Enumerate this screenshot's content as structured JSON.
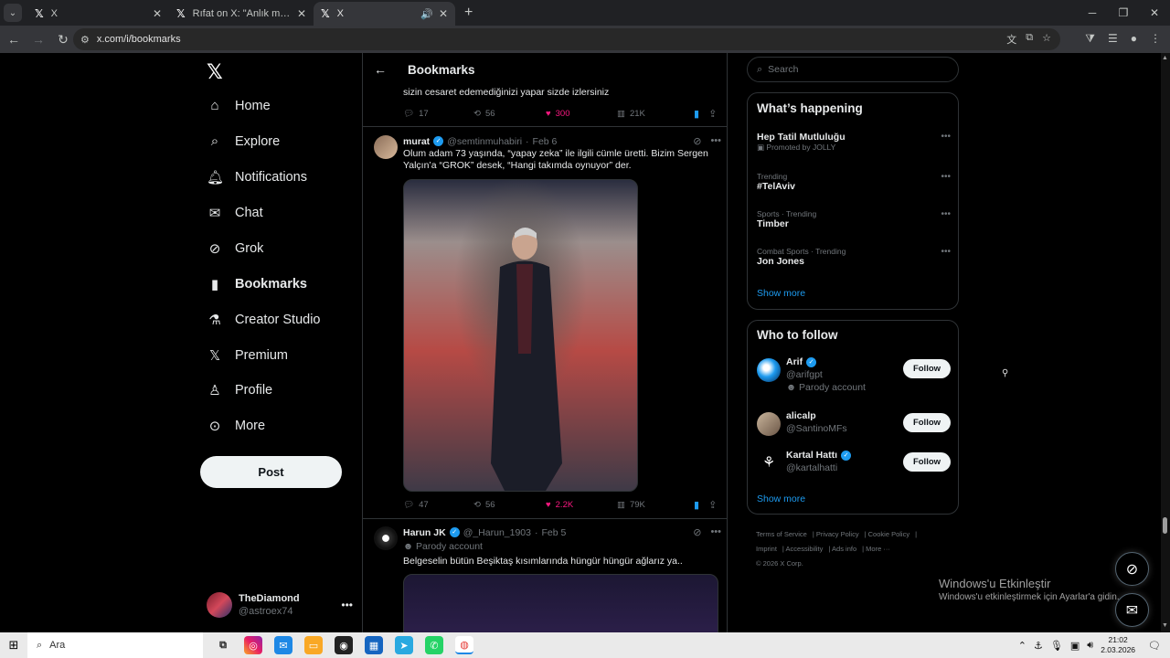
{
  "browser": {
    "tabs": [
      {
        "title": "X",
        "active": false
      },
      {
        "title": "Rıfat on X: \"Anlık mma taymı hd\"",
        "active": false
      },
      {
        "title": "X",
        "active": true
      }
    ],
    "url": "x.com/i/bookmarks"
  },
  "nav": {
    "items": [
      {
        "label": "Home",
        "icon": "home-icon"
      },
      {
        "label": "Explore",
        "icon": "search-icon"
      },
      {
        "label": "Notifications",
        "icon": "bell-icon"
      },
      {
        "label": "Chat",
        "icon": "mail-icon"
      },
      {
        "label": "Grok",
        "icon": "grok-icon"
      },
      {
        "label": "Bookmarks",
        "icon": "bookmark-icon"
      },
      {
        "label": "Creator Studio",
        "icon": "flask-icon"
      },
      {
        "label": "Premium",
        "icon": "x-icon"
      },
      {
        "label": "Profile",
        "icon": "person-icon"
      },
      {
        "label": "More",
        "icon": "more-circle-icon"
      }
    ],
    "post_label": "Post",
    "account": {
      "name": "TheDiamond",
      "handle": "@astroex74"
    }
  },
  "header": {
    "title": "Bookmarks"
  },
  "feed": {
    "fragment": {
      "text": "sizin cesaret edemediğinizi yapar sizde izlersiniz",
      "replies": "17",
      "reposts": "56",
      "likes": "300",
      "views": "21K"
    },
    "tweets": [
      {
        "name": "murat",
        "handle": "@semtinmuhabiri",
        "date": "Feb 6",
        "text": "Olum adam 73 yaşında, “yapay zeka” ile ilgili cümle üretti. Bizim Sergen Yalçın’a “GROK” desek, “Hangi takımda oynuyor” der.",
        "replies": "47",
        "reposts": "56",
        "likes": "2.2K",
        "views": "79K"
      },
      {
        "name": "Harun JK",
        "handle": "@_Harun_1903",
        "date": "Feb 5",
        "parody": "Parody account",
        "text": "Belgeselin bütün Beşiktaş kısımlarında hüngür hüngür ağlarız ya.."
      }
    ]
  },
  "right": {
    "search_placeholder": "Search",
    "happening": {
      "title": "What’s happening",
      "trends": [
        {
          "title": "Hep Tatil Mutluluğu",
          "context": "Promoted by JOLLY"
        },
        {
          "context": "Trending",
          "title": "#TelAviv"
        },
        {
          "context": "Sports · Trending",
          "title": "Timber"
        },
        {
          "context": "Combat Sports · Trending",
          "title": "Jon Jones"
        }
      ],
      "show_more": "Show more"
    },
    "who_to_follow": {
      "title": "Who to follow",
      "users": [
        {
          "name": "Arif",
          "handle": "@arifgpt",
          "note": "Parody account",
          "follow": "Follow"
        },
        {
          "name": "alicalp",
          "handle": "@SantinoMFs",
          "follow": "Follow"
        },
        {
          "name": "Kartal Hattı",
          "handle": "@kartalhatti",
          "follow": "Follow"
        }
      ],
      "show_more": "Show more"
    },
    "footer": {
      "line1": [
        "Terms of Service",
        "Privacy Policy",
        "Cookie Policy"
      ],
      "line2": [
        "Imprint",
        "Accessibility",
        "Ads info",
        "More ···"
      ],
      "copyright": "© 2026 X Corp."
    }
  },
  "watermark": {
    "line1": "Windows'u Etkinleştir",
    "line2": "Windows'u etkinleştirmek için Ayarlar'a gidin."
  },
  "taskbar": {
    "search": "Ara",
    "time": "21:02",
    "date": "2.03.2026"
  },
  "colors": {
    "accent": "#1d9bf0",
    "like": "#f91880",
    "border": "#2f3336",
    "muted": "#71767b"
  }
}
